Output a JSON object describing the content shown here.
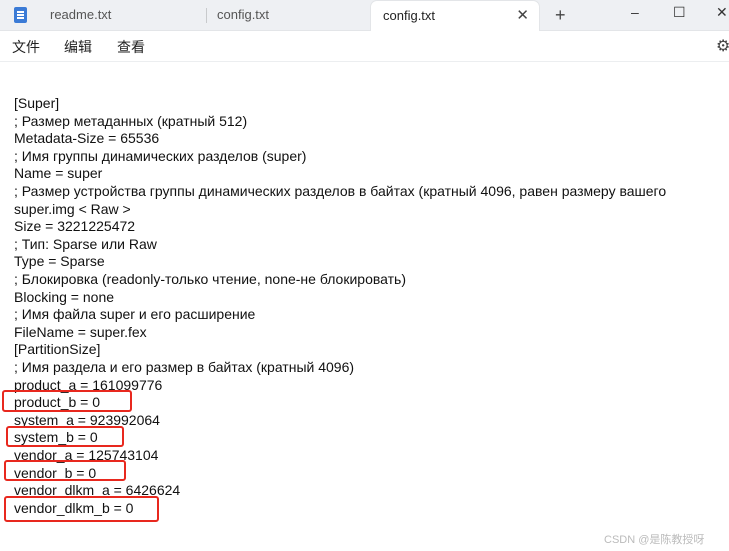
{
  "tabs": [
    {
      "label": "readme.txt",
      "active": false
    },
    {
      "label": "config.txt",
      "active": false
    },
    {
      "label": "config.txt",
      "active": true,
      "close": "✕"
    }
  ],
  "new_tab": "+",
  "window": {
    "minimize": "–",
    "maximize": "☐",
    "close": "✕"
  },
  "menu": [
    "文件",
    "编辑",
    "查看"
  ],
  "lines": [
    "[Super]",
    "; Размер метаданных (кратный 512)",
    "Metadata-Size = 65536",
    "; Имя группы динамических разделов (super)",
    "Name = super",
    "; Размер устройства группы динамических разделов в байтах (кратный 4096, равен размеру вашего",
    "super.img < Raw >",
    "Size = 3221225472",
    "; Тип: Sparse или Raw",
    "Type = Sparse",
    "; Блокировка (readonly-только чтение, none-не блокировать)",
    "Blocking = none",
    "; Имя файла super и его расширение",
    "FileName = super.fex",
    "[PartitionSize]",
    "; Имя раздела и его размер в байтах (кратный 4096)",
    "product_a = 161099776",
    "product_b = 0",
    "system_a = 923992064",
    "system_b = 0",
    "vendor_a = 125743104",
    "vendor_b = 0",
    "vendor_dlkm_a = 6426624",
    "vendor_dlkm_b = 0"
  ],
  "watermark": "CSDN @是陈教授呀",
  "colors": {
    "highlight": "#e8281e",
    "titlebar": "#eef0f3"
  }
}
